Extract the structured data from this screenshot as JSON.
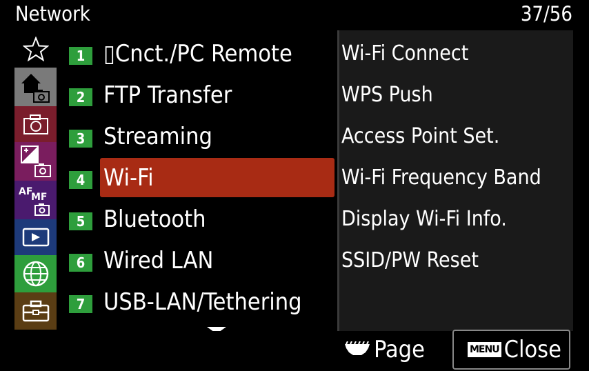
{
  "header": {
    "title": "Network",
    "page_count": "37/56"
  },
  "sidebar": {
    "tabs": [
      {
        "name": "my-menu",
        "icon": "star-icon"
      },
      {
        "name": "main",
        "icon": "home-camera-icon",
        "active": true
      },
      {
        "name": "shooting",
        "icon": "camera-icon"
      },
      {
        "name": "exposure",
        "icon": "exposure-camera-icon"
      },
      {
        "name": "focus",
        "icon": "af-mf-icon",
        "icon_text": "AF",
        "icon_sub": "MF"
      },
      {
        "name": "playback",
        "icon": "playback-icon"
      },
      {
        "name": "network",
        "icon": "globe-icon",
        "selected": true
      },
      {
        "name": "setup",
        "icon": "toolbox-icon"
      }
    ]
  },
  "menu": {
    "items": [
      {
        "num": "1",
        "label": "▯Cnct./PC Remote"
      },
      {
        "num": "2",
        "label": "FTP Transfer"
      },
      {
        "num": "3",
        "label": "Streaming"
      },
      {
        "num": "4",
        "label": "Wi-Fi",
        "selected": true
      },
      {
        "num": "5",
        "label": "Bluetooth"
      },
      {
        "num": "6",
        "label": "Wired LAN"
      },
      {
        "num": "7",
        "label": "USB-LAN/Tethering"
      }
    ]
  },
  "submenu": {
    "items": [
      "Wi-Fi Connect",
      "WPS Push",
      "Access Point Set.",
      "Wi-Fi Frequency Band",
      "Display Wi-Fi Info.",
      "SSID/PW Reset"
    ]
  },
  "footer": {
    "page_label": "Page",
    "menu_badge": "MENU",
    "close_label": "Close"
  },
  "colors": {
    "selection": "#a82b14",
    "number_badge": "#2e9e3c",
    "tab_network": "#2e9e3c"
  }
}
